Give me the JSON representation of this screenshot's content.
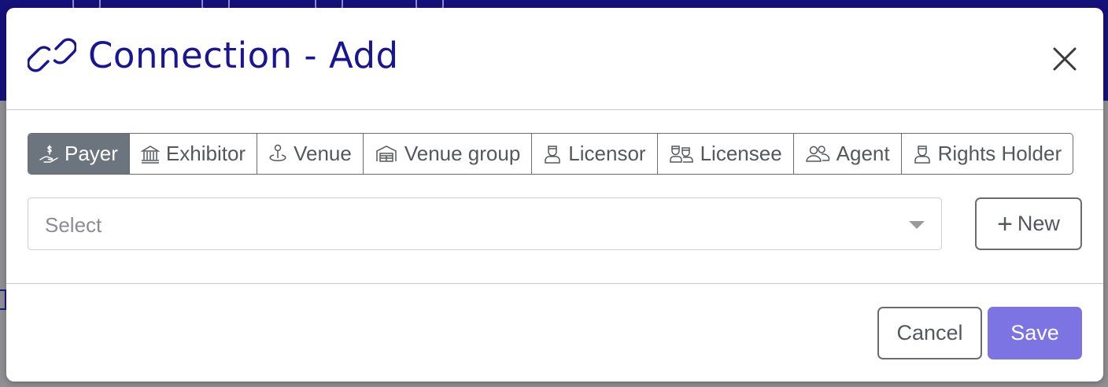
{
  "modal": {
    "title": "Connection - Add",
    "title_icon": "link-icon",
    "close_icon": "close-icon"
  },
  "tabs": [
    {
      "label": "Payer",
      "icon": "hand-money-icon",
      "active": true
    },
    {
      "label": "Exhibitor",
      "icon": "bank-icon",
      "active": false
    },
    {
      "label": "Venue",
      "icon": "location-person-icon",
      "active": false
    },
    {
      "label": "Venue group",
      "icon": "warehouse-icon",
      "active": false
    },
    {
      "label": "Licensor",
      "icon": "person-badge-icon",
      "active": false
    },
    {
      "label": "Licensee",
      "icon": "people-badge-icon",
      "active": false
    },
    {
      "label": "Agent",
      "icon": "users-icon",
      "active": false
    },
    {
      "label": "Rights Holder",
      "icon": "person-badge-icon",
      "active": false
    }
  ],
  "select": {
    "placeholder": "Select"
  },
  "new_button": {
    "label": "New",
    "icon": "plus-icon"
  },
  "footer": {
    "cancel_label": "Cancel",
    "save_label": "Save"
  },
  "colors": {
    "title": "#1a1592",
    "active_tab": "#6c757d",
    "save_button": "#7b74e2",
    "backdrop_top": "#15117a"
  }
}
